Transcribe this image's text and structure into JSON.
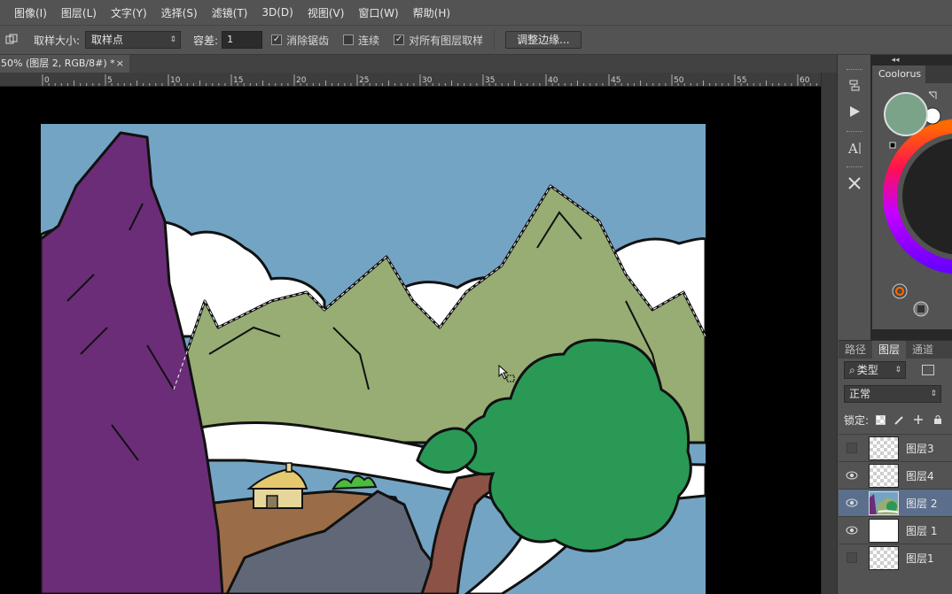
{
  "menu": [
    "图像(I)",
    "图层(L)",
    "文字(Y)",
    "选择(S)",
    "滤镜(T)",
    "3D(D)",
    "视图(V)",
    "窗口(W)",
    "帮助(H)"
  ],
  "options": {
    "sample_size_label": "取样大小:",
    "sample_size_value": "取样点",
    "tolerance_label": "容差:",
    "tolerance_value": "1",
    "antialias_label": "消除锯齿",
    "antialias_checked": true,
    "contiguous_label": "连续",
    "contiguous_checked": false,
    "sample_all_label": "对所有图层取样",
    "sample_all_checked": true,
    "refine_edge_label": "调整边缘..."
  },
  "document_tab": {
    "title": "50% (图层 2, RGB/8#) *",
    "close": "×"
  },
  "ruler": {
    "ticks": [
      "0",
      "5",
      "10",
      "15",
      "20",
      "25",
      "30",
      "35",
      "40",
      "45",
      "50",
      "55",
      "60"
    ]
  },
  "panel_collapse": "◂◂",
  "color_panel": {
    "tab": "Coolorus",
    "foreground_color": "#7aa38a",
    "background_color": "#ffffff"
  },
  "layers_panel": {
    "tabs": [
      "路径",
      "图层",
      "通道"
    ],
    "active_tab": "图层",
    "filter_value": "类型",
    "blend_mode": "正常",
    "lock_label": "锁定:",
    "layers": [
      {
        "name": "图层3",
        "visible": false,
        "thumb": "checker",
        "selected": false
      },
      {
        "name": "图层4",
        "visible": true,
        "thumb": "checker",
        "selected": false
      },
      {
        "name": "图层 2",
        "visible": true,
        "thumb": "art",
        "selected": true
      },
      {
        "name": "图层 1",
        "visible": true,
        "thumb": "white",
        "selected": false
      },
      {
        "name": "图层1",
        "visible": false,
        "thumb": "checker",
        "selected": false
      }
    ]
  },
  "colors": {
    "sky": "#74a4c4",
    "mountains": "#98ad74",
    "purple_rock": "#6b2d78",
    "tree": "#2a9955",
    "trunk": "#8c5246",
    "ground": "#9a6d48",
    "rock": "#606878",
    "selection_accent": "#5b6f8c"
  }
}
